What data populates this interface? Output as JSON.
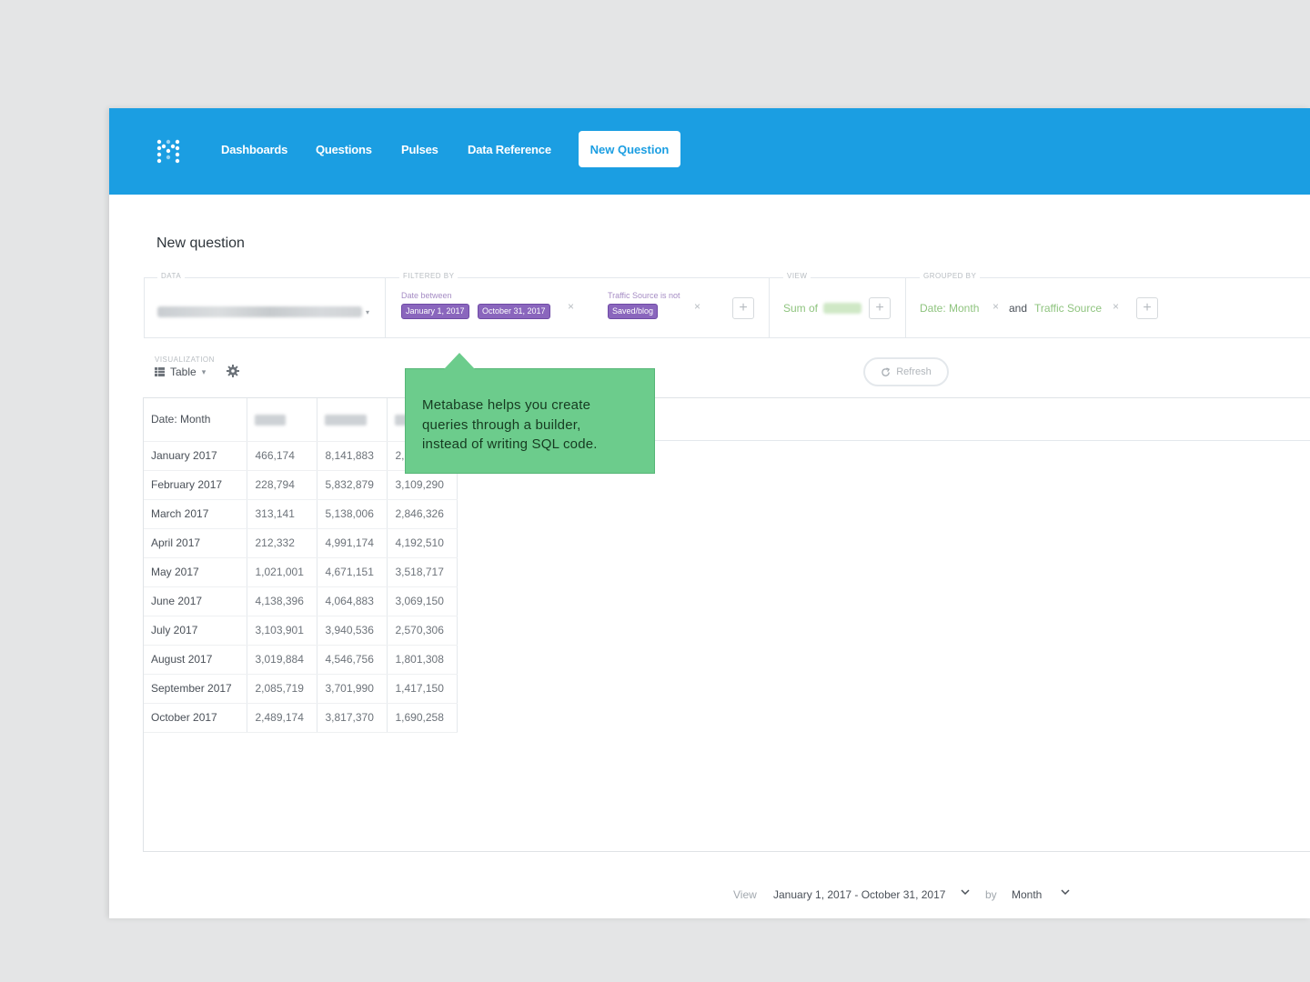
{
  "nav": {
    "links": [
      "Dashboards",
      "Questions",
      "Pulses",
      "Data Reference"
    ],
    "new_question": "New Question"
  },
  "page": {
    "title": "New question"
  },
  "query": {
    "data_label": "Data",
    "filtered_label": "Filtered by",
    "date_filter_label": "Date between",
    "date_start": "January 1, 2017",
    "date_end": "October 31, 2017",
    "traffic_filter_label": "Traffic Source is not",
    "traffic_value": "Saved/blog",
    "view_label": "View",
    "view_value": "Sum of",
    "grouped_label": "Grouped by",
    "group_1": "Date: Month",
    "group_and": "and",
    "group_2": "Traffic Source"
  },
  "visualization": {
    "label": "Visualization",
    "value": "Table"
  },
  "refresh": {
    "label": "Refresh"
  },
  "tooltip": {
    "line1": "Metabase helps you create",
    "line2": "queries through a builder,",
    "line3": "instead of writing SQL code."
  },
  "table": {
    "header": "Date: Month",
    "rows": [
      [
        "January 2017",
        "466,174",
        "8,141,883",
        "2,3"
      ],
      [
        "February 2017",
        "228,794",
        "5,832,879",
        "3,109,290"
      ],
      [
        "March 2017",
        "313,141",
        "5,138,006",
        "2,846,326"
      ],
      [
        "April 2017",
        "212,332",
        "4,991,174",
        "4,192,510"
      ],
      [
        "May 2017",
        "1,021,001",
        "4,671,151",
        "3,518,717"
      ],
      [
        "June 2017",
        "4,138,396",
        "4,064,883",
        "3,069,150"
      ],
      [
        "July 2017",
        "3,103,901",
        "3,940,536",
        "2,570,306"
      ],
      [
        "August 2017",
        "3,019,884",
        "4,546,756",
        "1,801,308"
      ],
      [
        "September 2017",
        "2,085,719",
        "3,701,990",
        "1,417,150"
      ],
      [
        "October 2017",
        "2,489,174",
        "3,817,370",
        "1,690,258"
      ]
    ]
  },
  "footer": {
    "view_label": "View",
    "date_range": "January 1, 2017 - October 31, 2017",
    "by_label": "by",
    "period": "Month"
  },
  "colors": {
    "navbar": "#1b9ee2",
    "filter_purple": "#8a66bd",
    "breakout_green": "#8fc47f",
    "tooltip_green": "#6ccc8c"
  },
  "icons": [
    "metabase-logo-icon",
    "close-icon",
    "plus-icon",
    "table-icon",
    "gear-icon",
    "refresh-icon",
    "chevron-down-icon"
  ]
}
